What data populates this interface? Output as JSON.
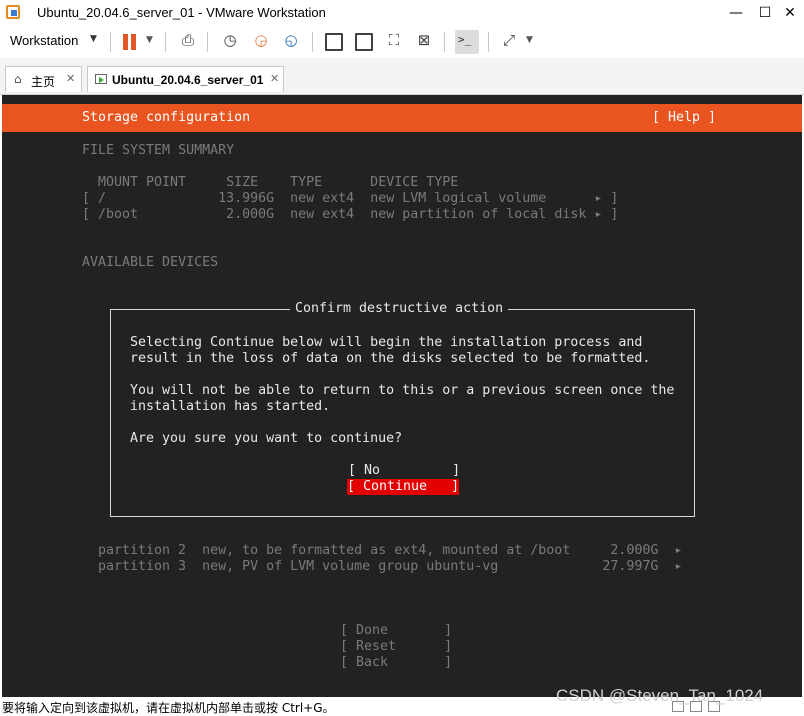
{
  "window": {
    "title": "Ubuntu_20.04.6_server_01 - VMware Workstation",
    "minimize": "—",
    "maximize": "☐",
    "close": "✕"
  },
  "toolbar": {
    "workstation_label": "Workstation",
    "icons": [
      "pause-icon",
      "send-ctrl-alt-del-icon",
      "snapshot-icon",
      "revert-snapshot-icon",
      "snapshot-manager-icon",
      "sidebar-toggle-icon",
      "thumbnail-icon",
      "full-screen-icon",
      "unity-icon",
      "console-view-icon",
      "stretch-icon"
    ]
  },
  "tabs": [
    {
      "label": "主页",
      "icon": "home-icon"
    },
    {
      "label": "Ubuntu_20.04.6_server_01",
      "icon": "vm-icon"
    }
  ],
  "console": {
    "header_title": "Storage configuration",
    "help": "[ Help ]",
    "fs_summary_title": "FILE SYSTEM SUMMARY",
    "fs_table": {
      "header": "MOUNT POINT     SIZE    TYPE      DEVICE TYPE",
      "rows": [
        "[ /              13.996G  new ext4  new LVM logical volume      ▸ ]",
        "[ /boot           2.000G  new ext4  new partition of local disk ▸ ]"
      ]
    },
    "available_devices_title": "AVAILABLE DEVICES",
    "partitions": [
      "partition 2  new, to be formatted as ext4, mounted at /boot     2.000G  ▸",
      "partition 3  new, PV of LVM volume group ubuntu-vg             27.997G  ▸"
    ],
    "actions": {
      "done": "[ Done       ]",
      "reset": "[ Reset      ]",
      "back": "[ Back       ]"
    },
    "dialog": {
      "title": "Confirm destructive action",
      "lines": [
        "Selecting Continue below will begin the installation process and",
        "result in the loss of data on the disks selected to be formatted.",
        "You will not be able to return to this or a previous screen once the",
        "installation has started.",
        "Are you sure you want to continue?"
      ],
      "no_button": "[ No         ]",
      "continue_button": "[ Continue   ]"
    }
  },
  "status_bar": {
    "text": "要将输入定向到该虚拟机，请在虚拟机内部单击或按 Ctrl+G。",
    "watermark": "CSDN @Steven_Tan_1024"
  },
  "colors": {
    "ubuntu_orange": "#e95420",
    "console_bg": "#222222",
    "selected_button": "#e20000"
  }
}
